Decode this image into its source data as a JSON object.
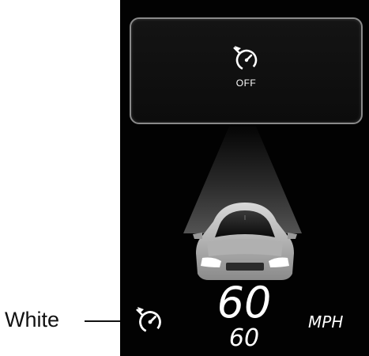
{
  "callout": {
    "label": "White"
  },
  "popup": {
    "icon": "cruise-control-icon",
    "status_text": "OFF"
  },
  "vehicle": {
    "icon": "lead-vehicle-car-icon"
  },
  "speed": {
    "current": "60",
    "set": "60",
    "unit": "MPH"
  },
  "indicator": {
    "icon": "cruise-control-icon",
    "color": "#ffffff"
  },
  "colors": {
    "display_background": "#020202",
    "popup_border": "#8a8a8a",
    "text": "#ffffff"
  }
}
